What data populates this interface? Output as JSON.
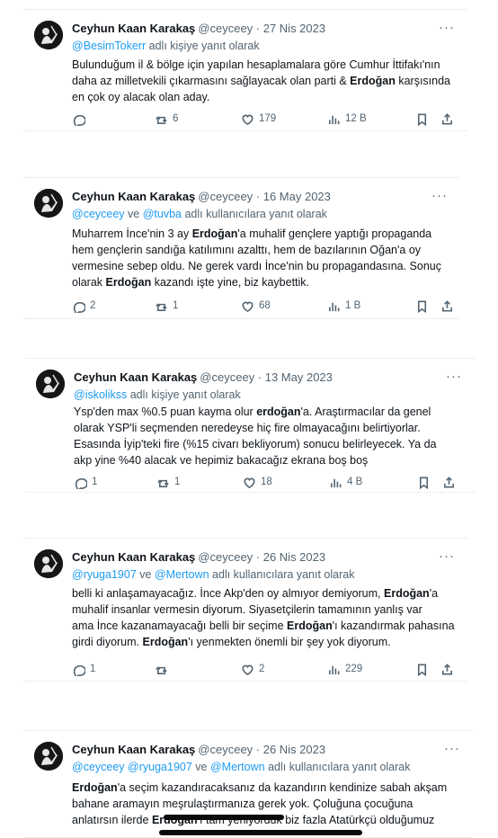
{
  "tweets": [
    {
      "name": "Ceyhun Kaan Karakaş",
      "meta": "@ceyceey · 27 Nis 2023",
      "reply_links": [
        "@BesimTokerr"
      ],
      "reply_suffix": "adlı kişiye yanıt olarak",
      "lines": [
        [
          "Bulunduğum il & bölge için yapılan hesaplamalara göre Cumhur İttifakı'nın"
        ],
        [
          "daha az milletvekili çıkarmasını sağlayacak olan parti & ",
          {
            "b": "Erdoğan"
          },
          " karşısında"
        ],
        [
          "en çok oy alacak olan aday."
        ]
      ],
      "stats": {
        "replies": "",
        "retweets": "6",
        "likes": "179",
        "views": "12 B"
      }
    },
    {
      "name": "Ceyhun Kaan Karakaş",
      "meta": "@ceyceey · 16 May 2023",
      "reply_links": [
        "@ceyceey",
        "@tuvba"
      ],
      "reply_joiner": "ve",
      "reply_suffix": "adlı kullanıcılara yanıt olarak",
      "lines": [
        [
          "Muharrem İnce'nin 3 ay ",
          {
            "b": "Erdoğan"
          },
          "'a muhalif gençlere yaptığı propaganda"
        ],
        [
          "hem gençlerin sandığa katılımını azalttı, hem de bazılarının Oğan'a oy"
        ],
        [
          "vermesine sebep oldu. Ne gerek vardı İnce'nin bu propagandasına. Sonuç"
        ],
        [
          "olarak ",
          {
            "b": "Erdoğan"
          },
          " kazandı işte yine, biz kaybettik."
        ]
      ],
      "stats": {
        "replies": "2",
        "retweets": "1",
        "likes": "68",
        "views": "1 B"
      }
    },
    {
      "name": "Ceyhun Kaan Karakaş",
      "meta": "@ceyceey · 13 May 2023",
      "reply_links": [
        "@iskolikss"
      ],
      "reply_suffix": "adlı kişiye yanıt olarak",
      "lines": [
        [
          "Ysp'den max %0.5 puan kayma olur ",
          {
            "b": "erdoğan"
          },
          "'a. Araştırmacılar da genel"
        ],
        [
          "olarak YSP'li seçmenden neredeyse hiç fire olmayacağını belirtiyorlar."
        ],
        [
          "Esasında İyip'teki fire (%15 civarı bekliyorum) sonucu belirleyecek. Ya da"
        ],
        [
          "akp yine %40 alacak ve hepimiz bakacağız ekrana boş boş"
        ]
      ],
      "stats": {
        "replies": "1",
        "retweets": "1",
        "likes": "18",
        "views": "4 B"
      }
    },
    {
      "name": "Ceyhun Kaan Karakaş",
      "meta": "@ceyceey · 26 Nis 2023",
      "reply_links": [
        "@ryuga1907",
        "@Mertown"
      ],
      "reply_joiner": "ve",
      "reply_suffix": "adlı kullanıcılara yanıt olarak",
      "lines": [
        [
          "belli ki anlaşamayacağız. İnce Akp'den oy almıyor demiyorum, ",
          {
            "b": "Erdoğan"
          },
          "'a"
        ],
        [
          "muhalif insanlar vermesin diyorum. Siyasetçilerin tamamının yanlış var"
        ],
        [
          "ama İnce kazanamayacağı belli bir seçime ",
          {
            "b": "Erdoğan"
          },
          "'ı kazandırmak pahasına"
        ],
        [
          "girdi diyorum. ",
          {
            "b": "Erdoğan"
          },
          "'ı yenmekten önemli bir şey yok diyorum."
        ]
      ],
      "stats": {
        "replies": "1",
        "retweets": "",
        "likes": "2",
        "views": "229"
      }
    },
    {
      "name": "Ceyhun Kaan Karakaş",
      "meta": "@ceyceey · 26 Nis 2023",
      "reply_links": [
        "@ceyceey",
        "@ryuga1907",
        "@Mertown"
      ],
      "reply_joiner": "ve",
      "reply_suffix": "adlı kullanıcılara yanıt olarak",
      "lines": [
        [
          {
            "b": "Erdoğan"
          },
          "'a seçim kazandıracaksanız da kazandırın kendinize sabah akşam"
        ],
        [
          "bahane aramayın meşrulaştırmanıza gerek yok. Çoluğuna çocuğuna"
        ],
        [
          "anlatırsın ilerde ",
          {
            "b": "Erdoğan"
          },
          "'ı tam yeniyorduk biz fazla Atatürkçü olduğumuz"
        ]
      ],
      "stats": null
    }
  ],
  "icons": {
    "reply": "reply-icon",
    "retweet": "retweet-icon",
    "like": "heart-icon",
    "views": "views-icon",
    "bookmark": "bookmark-icon",
    "share": "share-icon",
    "more": "more-icon"
  },
  "colors": {
    "link": "#1d9bf0",
    "muted": "#536471",
    "text": "#0f1419"
  }
}
